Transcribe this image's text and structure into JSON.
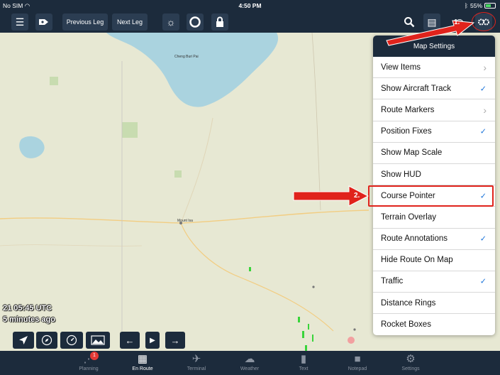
{
  "status": {
    "carrier": "No SIM",
    "time": "4:50 PM",
    "battery": "55%"
  },
  "toolbar": {
    "previous_leg": "Previous Leg",
    "next_leg": "Next Leg"
  },
  "map_settings": {
    "title": "Map Settings",
    "items": [
      {
        "label": "View Items",
        "mark": "›"
      },
      {
        "label": "Show Aircraft Track",
        "mark": "✓"
      },
      {
        "label": "Route Markers",
        "mark": "›"
      },
      {
        "label": "Position Fixes",
        "mark": "✓"
      },
      {
        "label": "Show Map Scale",
        "mark": ""
      },
      {
        "label": "Show HUD",
        "mark": ""
      },
      {
        "label": "Course Pointer",
        "mark": "✓"
      },
      {
        "label": "Terrain Overlay",
        "mark": ""
      },
      {
        "label": "Route Annotations",
        "mark": "✓"
      },
      {
        "label": "Hide Route On Map",
        "mark": ""
      },
      {
        "label": "Traffic",
        "mark": "✓"
      },
      {
        "label": "Distance Rings",
        "mark": ""
      },
      {
        "label": "Rocket Boxes",
        "mark": ""
      }
    ]
  },
  "map": {
    "time_utc": "21 05:45 UTC",
    "age": "5 minutes ago",
    "city_labels": [
      "Cheng Buri Pai",
      "Mount Isa"
    ]
  },
  "annotations": {
    "step1": "1.",
    "step2": "2."
  },
  "tabs": [
    {
      "label": "Planning",
      "badge": "1"
    },
    {
      "label": "En Route"
    },
    {
      "label": "Terminal"
    },
    {
      "label": "Weather"
    },
    {
      "label": "Text"
    },
    {
      "label": "Notepad"
    },
    {
      "label": "Settings"
    }
  ],
  "colors": {
    "navbar": "#1c2b3c",
    "check": "#1a73d9",
    "annotation": "#e0231c",
    "water": "#aad3df",
    "park": "#c8dcb0"
  }
}
